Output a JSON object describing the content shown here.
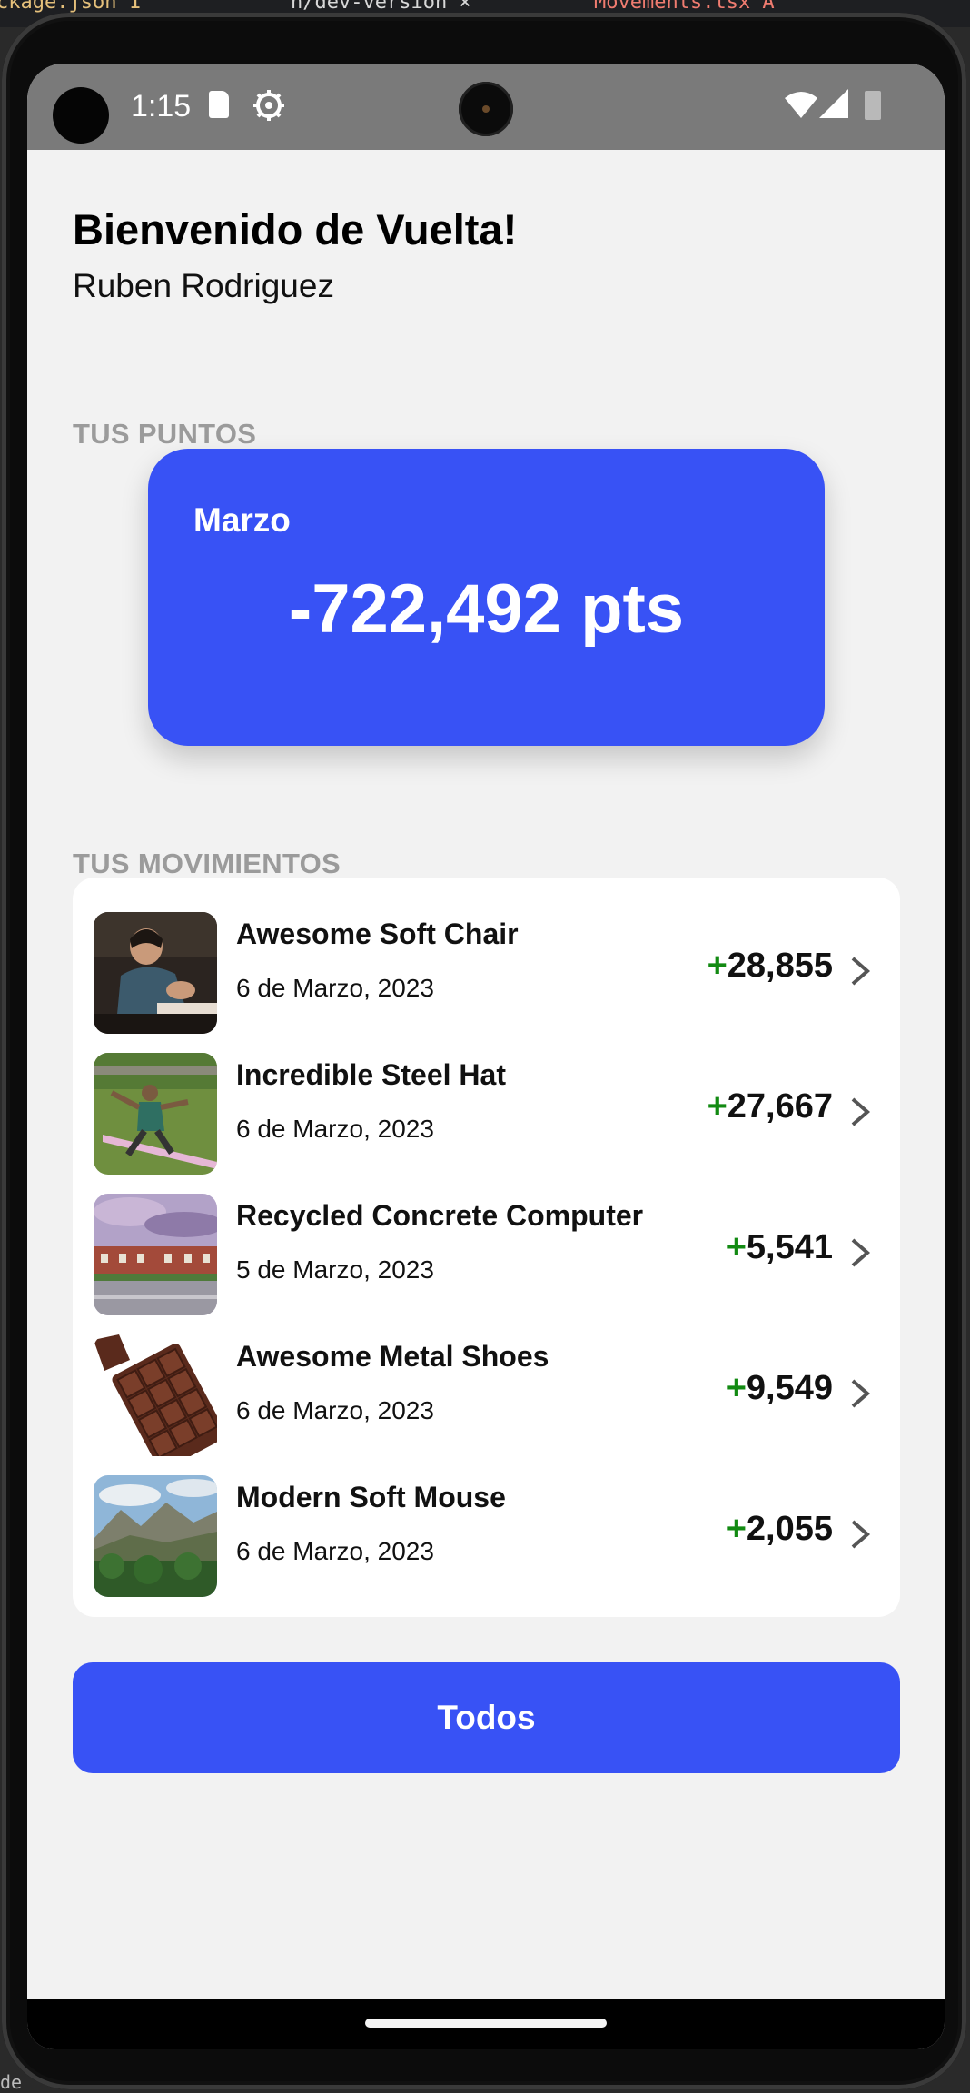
{
  "desktop": {
    "fragment_left": "ckage.json 1",
    "fragment_middle": "n/dev-version  ×",
    "fragment_right": "Movements.tsx  A",
    "fragment_bottom": "de"
  },
  "status_bar": {
    "time": "1:15",
    "icons": [
      "sd-card-icon",
      "settings-gear-icon",
      "wifi-icon",
      "cell-signal-icon",
      "battery-icon"
    ]
  },
  "header": {
    "greeting": "Bienvenido de Vuelta!",
    "user_name": "Ruben Rodriguez"
  },
  "points_section": {
    "label": "TUS PUNTOS",
    "month": "Marzo",
    "total": "-722,492 pts"
  },
  "movements_section": {
    "label": "TUS MOVIMIENTOS",
    "items": [
      {
        "name": "Awesome Soft Chair",
        "date": "6 de Marzo, 2023",
        "sign": "+",
        "points": "28,855",
        "thumb_icon": "person-working-photo"
      },
      {
        "name": "Incredible Steel Hat",
        "date": "6 de Marzo, 2023",
        "sign": "+",
        "points": "27,667",
        "thumb_icon": "park-slackline-photo"
      },
      {
        "name": "Recycled Concrete Computer",
        "date": "5 de Marzo, 2023",
        "sign": "+",
        "points": "5,541",
        "thumb_icon": "town-street-photo"
      },
      {
        "name": "Awesome Metal Shoes",
        "date": "6 de Marzo, 2023",
        "sign": "+",
        "points": "9,549",
        "thumb_icon": "chocolate-bar-photo"
      },
      {
        "name": "Modern Soft Mouse",
        "date": "6 de Marzo, 2023",
        "sign": "+",
        "points": "2,055",
        "thumb_icon": "mountain-forest-photo"
      }
    ]
  },
  "actions": {
    "all_button": "Todos"
  },
  "colors": {
    "accent": "#3852f5",
    "positive": "#128a12",
    "section_label": "#9b9b9b",
    "background": "#f2f2f2"
  }
}
